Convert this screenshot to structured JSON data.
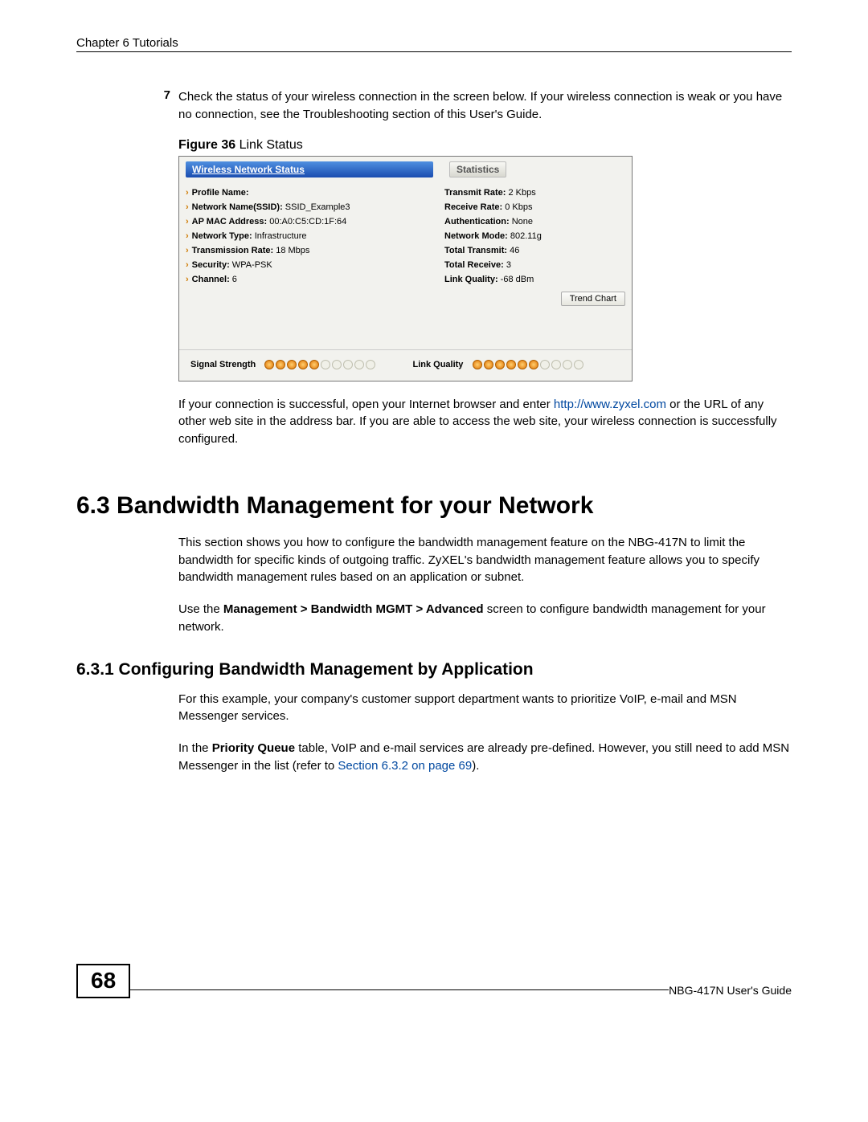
{
  "header": "Chapter 6 Tutorials",
  "step": {
    "num": "7",
    "text": "Check the status of your wireless connection in the screen below. If your wireless connection is weak or you have no connection, see the Troubleshooting section of this User's Guide."
  },
  "figure": {
    "label_bold": "Figure 36",
    "label_rest": "   Link Status",
    "left_title": "Wireless Network Status",
    "right_title": "Statistics",
    "left_rows": [
      {
        "k": "Profile Name:",
        "v": ""
      },
      {
        "k": "Network Name(SSID):",
        "v": "SSID_Example3"
      },
      {
        "k": "AP MAC Address:",
        "v": "00:A0:C5:CD:1F:64"
      },
      {
        "k": "Network Type:",
        "v": "Infrastructure"
      },
      {
        "k": "Transmission Rate:",
        "v": "18 Mbps"
      },
      {
        "k": "Security:",
        "v": "WPA-PSK"
      },
      {
        "k": "Channel:",
        "v": "6"
      }
    ],
    "right_rows": [
      {
        "k": "Transmit Rate:",
        "v": "2 Kbps"
      },
      {
        "k": "Receive Rate:",
        "v": "0 Kbps"
      },
      {
        "k": "Authentication:",
        "v": "None"
      },
      {
        "k": "Network Mode:",
        "v": "802.11g"
      },
      {
        "k": "Total Transmit:",
        "v": "46"
      },
      {
        "k": "Total Receive:",
        "v": "3"
      },
      {
        "k": "Link Quality:",
        "v": "-68 dBm"
      }
    ],
    "trend_chart": "Trend Chart",
    "signal_strength_label": "Signal Strength",
    "link_quality_label": "Link Quality",
    "signal_dots_on": 5,
    "signal_dots_total": 10,
    "lq_dots_on": 6,
    "lq_dots_total": 10
  },
  "post_figure": {
    "t1": "If your connection is successful, open your Internet browser and enter ",
    "link": "http://www.zyxel.com",
    "t2": " or the URL of any other web site in the address bar. If you are able to access the web site, your wireless connection is successfully configured."
  },
  "section": {
    "num_title": "6.3  Bandwidth Management for your Network",
    "para1": "This section shows you how to configure the bandwidth management feature on the NBG-417N to limit the bandwidth for specific kinds of outgoing traffic. ZyXEL's bandwidth management feature allows you to specify bandwidth management rules based on an application or subnet.",
    "para2a": "Use the ",
    "para2b_bold": "Management > Bandwidth MGMT > Advanced",
    "para2c": " screen to configure bandwidth management for your network."
  },
  "subsection": {
    "num_title": "6.3.1  Configuring Bandwidth Management by Application",
    "para1": "For this example, your company's customer support department wants to prioritize VoIP, e-mail and MSN Messenger services.",
    "para2a": "In the ",
    "para2b_bold": "Priority Queue",
    "para2c": " table, VoIP and e-mail services are already pre-defined. However, you still need to add MSN Messenger in the list (refer to ",
    "para2_link": "Section 6.3.2 on page 69",
    "para2d": ")."
  },
  "footer": {
    "page": "68",
    "guide": "NBG-417N User's Guide"
  }
}
